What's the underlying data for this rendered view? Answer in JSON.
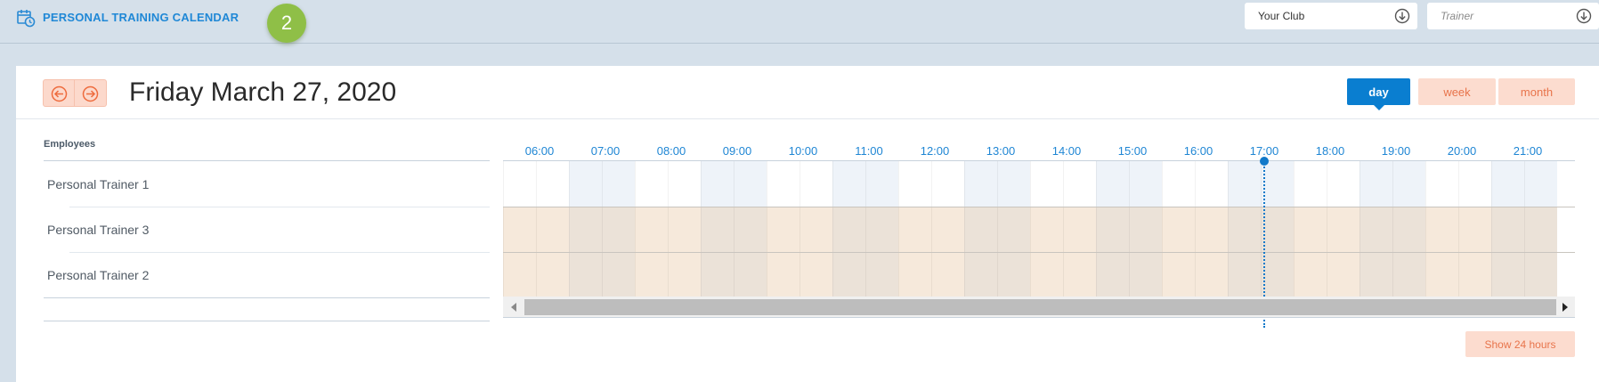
{
  "header": {
    "app_title": "PERSONAL TRAINING CALENDAR",
    "step_badge": "2",
    "club_select": {
      "value": "Your Club"
    },
    "trainer_select": {
      "placeholder": "Trainer"
    }
  },
  "calendar": {
    "date_title": "Friday March 27, 2020",
    "views": {
      "day": "day",
      "week": "week",
      "month": "month"
    },
    "active_view": "day",
    "employees_header": "Employees",
    "employees": [
      "Personal Trainer 1",
      "Personal Trainer 3",
      "Personal Trainer 2"
    ],
    "hours": [
      "06:00",
      "07:00",
      "08:00",
      "09:00",
      "10:00",
      "11:00",
      "12:00",
      "13:00",
      "14:00",
      "15:00",
      "16:00",
      "17:00",
      "18:00",
      "19:00",
      "20:00",
      "21:00"
    ],
    "current_time_hour": "17:00",
    "show_24_label": "Show 24 hours"
  },
  "colors": {
    "accent": "#1f86d4",
    "primary_button": "#0a7ed0",
    "secondary_button": "#fcdccf",
    "secondary_text": "#e8744b",
    "badge": "#8fbf47"
  },
  "icons": {
    "app": "calendar-clock-icon",
    "prev": "arrow-left-circle-icon",
    "next": "arrow-right-circle-icon",
    "select": "arrow-down-circle-icon"
  }
}
